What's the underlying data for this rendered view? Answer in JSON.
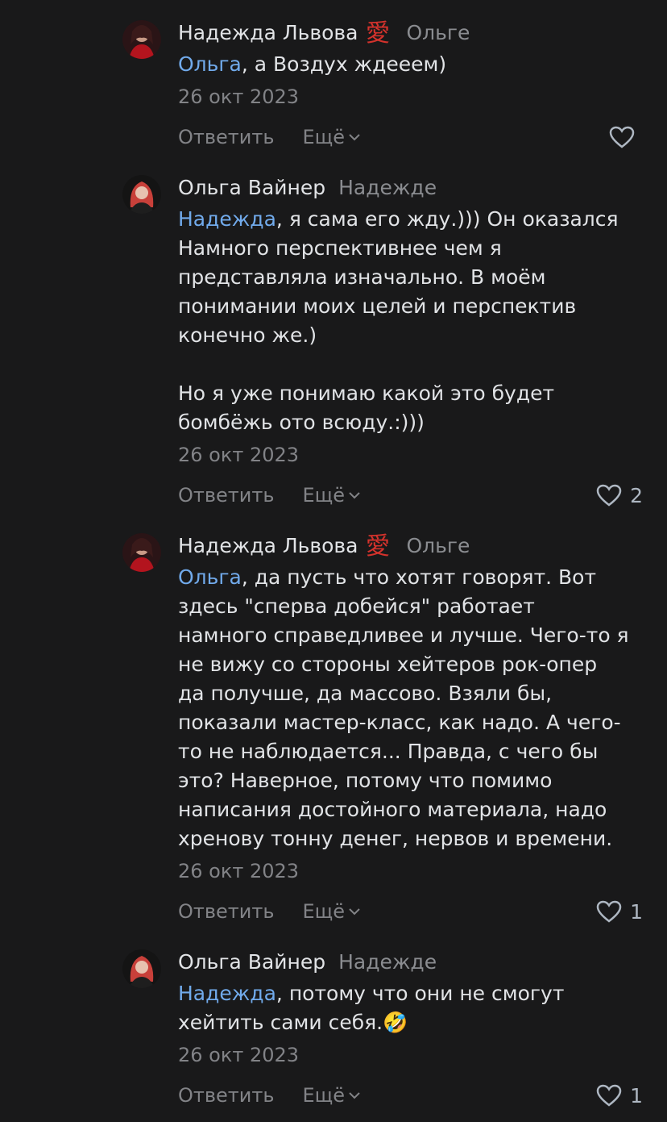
{
  "ui": {
    "reply_label": "Ответить",
    "more_label": "Ещё"
  },
  "comments": [
    {
      "author": "Надежда Львова",
      "badge": "愛",
      "reply_to": "Ольге",
      "mention": "Ольга",
      "lines": [
        ", а Воздух ждееем)"
      ],
      "date": "26 окт 2023",
      "likes": ""
    },
    {
      "author": "Ольга Вайнер",
      "badge": "",
      "reply_to": "Надежде",
      "mention": "Надежда",
      "lines": [
        ", я сама его жду.))) Он оказался",
        "Намного перспективнее чем я",
        "представляла изначально. В моём",
        "понимании моих целей и перспектив",
        "конечно же.)",
        "",
        "Но я уже понимаю какой это будет",
        "бомбёжь ото всюду.:)))"
      ],
      "date": "26 окт 2023",
      "likes": "2"
    },
    {
      "author": "Надежда Львова",
      "badge": "愛",
      "reply_to": "Ольге",
      "mention": "Ольга",
      "lines": [
        ", да пусть что хотят говорят. Вот",
        "здесь \"сперва добейся\" работает",
        "намного справедливее и лучше. Чего-то я",
        "не вижу со стороны хейтеров рок-опер",
        "да получше, да массово. Взяли бы,",
        "показали мастер-класс, как надо. А чего-",
        "то не наблюдается... Правда, с чего бы",
        "это? Наверное, потому что помимо",
        "написания достойного материала, надо",
        "хренову тонну денег, нервов и времени."
      ],
      "date": "26 окт 2023",
      "likes": "1"
    },
    {
      "author": "Ольга Вайнер",
      "badge": "",
      "reply_to": "Надежде",
      "mention": "Надежда",
      "lines": [
        ", потому что они не смогут",
        "хейтить сами себя.🤣"
      ],
      "date": "26 окт 2023",
      "likes": "1"
    }
  ]
}
